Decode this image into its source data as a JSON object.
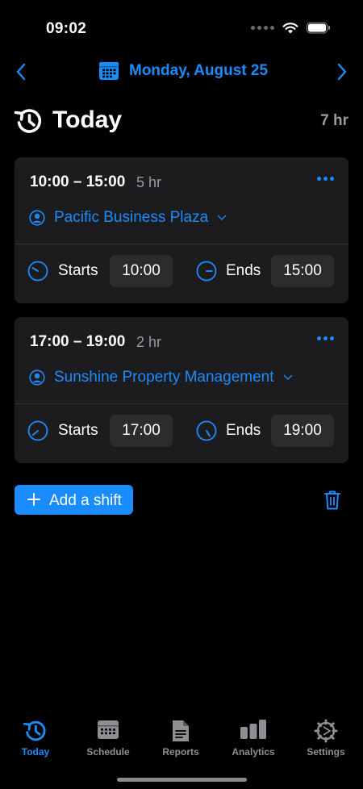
{
  "status_bar": {
    "time": "09:02"
  },
  "date_nav": {
    "date_label": "Monday, August 25"
  },
  "header": {
    "title": "Today",
    "total": "7 hr"
  },
  "shifts": [
    {
      "range": "10:00 – 15:00",
      "duration": "5 hr",
      "client": "Pacific Business Plaza",
      "starts_label": "Starts",
      "start_time": "10:00",
      "ends_label": "Ends",
      "end_time": "15:00"
    },
    {
      "range": "17:00 – 19:00",
      "duration": "2 hr",
      "client": "Sunshine Property Management",
      "starts_label": "Starts",
      "start_time": "17:00",
      "ends_label": "Ends",
      "end_time": "19:00"
    }
  ],
  "actions": {
    "add_shift_label": "Add a shift"
  },
  "tabs": [
    {
      "label": "Today",
      "icon": "history-clock-icon",
      "active": true
    },
    {
      "label": "Schedule",
      "icon": "calendar-grid-icon",
      "active": false
    },
    {
      "label": "Reports",
      "icon": "document-icon",
      "active": false
    },
    {
      "label": "Analytics",
      "icon": "bar-chart-icon",
      "active": false
    },
    {
      "label": "Settings",
      "icon": "gear-icon",
      "active": false
    }
  ],
  "colors": {
    "accent": "#1a8cff",
    "background": "#000000",
    "card": "#1c1c1e",
    "time_box": "#2c2c2e",
    "secondary_text": "#9a9a9f"
  }
}
